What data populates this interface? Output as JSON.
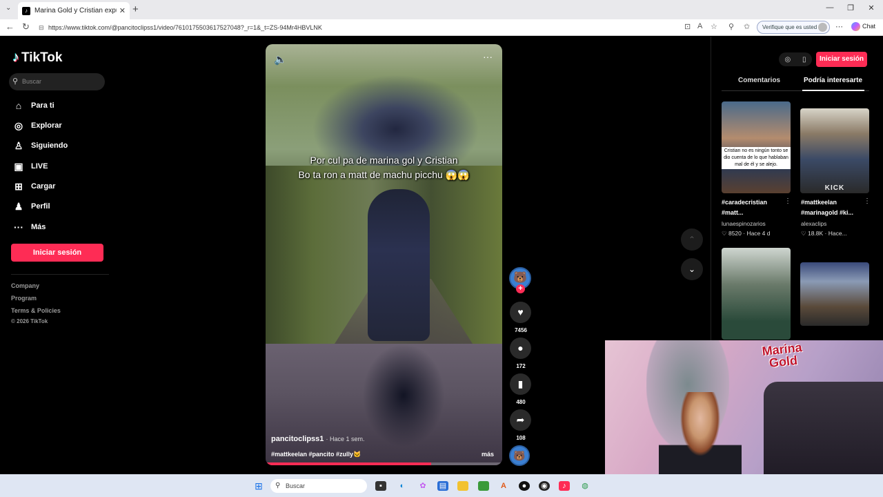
{
  "browser": {
    "tab_title": "Marina Gold y Cristian expulsados",
    "tab_close": "✕",
    "new_tab": "+",
    "url": "https://www.tiktok.com/@pancitoclipss1/video/7610175503617527048?_r=1&_t=ZS-94Mr4HBVLNK",
    "verify_label": "Verifique que es usted",
    "chat_label": "Chat"
  },
  "sidebar": {
    "logo": "TikTok",
    "search_placeholder": "Buscar",
    "items": [
      {
        "label": "Para ti",
        "icon": "⌂"
      },
      {
        "label": "Explorar",
        "icon": "◎"
      },
      {
        "label": "Siguiendo",
        "icon": "♙"
      },
      {
        "label": "LIVE",
        "icon": "▣"
      },
      {
        "label": "Cargar",
        "icon": "⊞"
      },
      {
        "label": "Perfil",
        "icon": "♟"
      },
      {
        "label": "Más",
        "icon": "···"
      }
    ],
    "login": "Iniciar sesión",
    "footer": [
      "Company",
      "Program",
      "Terms & Policies"
    ],
    "copyright": "© 2026 TikTok"
  },
  "video": {
    "caption_line1": "Por cul pa de marina gol y Cristian",
    "caption_line2": "Bo ta ron a matt de machu picchu 😱😱",
    "author": "pancitoclipss1",
    "posted": "· Hace 1 sem.",
    "hashtags": "#mattkeelan #pancito #zully🐱",
    "more": "más",
    "progress": 0.7
  },
  "actions": {
    "likes": "7456",
    "comments": "172",
    "saves": "480",
    "shares": "108"
  },
  "right_panel": {
    "login": "Iniciar sesión",
    "tabs": [
      "Comentarios",
      "Podría interesarte"
    ],
    "cards": [
      {
        "title": "#caradecristian #matt...",
        "user": "lunaespinozarios",
        "meta": "♡ 8520 · Hace 4 d",
        "overlay": "Cristian no es ningún tonto se dio cuenta de lo que hablaban mal de él y se alejo."
      },
      {
        "title": "#mattkeelan #marinagold #ki...",
        "user": "alexaclips",
        "meta": "♡ 18.8K · Hace...",
        "overlay": "KICK"
      }
    ]
  },
  "webcam": {
    "logo_line1": "Marina",
    "logo_line2": "Gold"
  },
  "taskbar": {
    "search": "Buscar"
  },
  "colors": {
    "accent": "#fe2c55",
    "background": "#000000"
  }
}
